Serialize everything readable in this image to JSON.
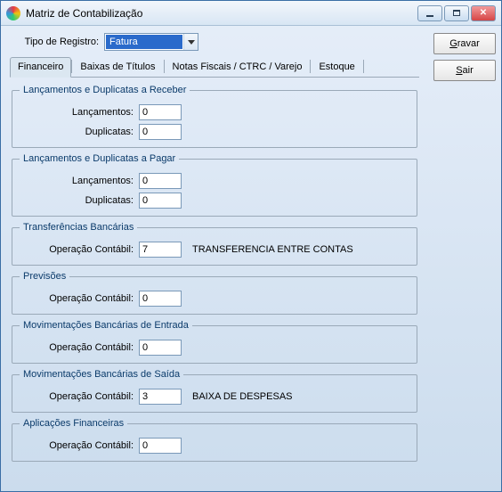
{
  "window": {
    "title": "Matriz de Contabilização"
  },
  "top": {
    "tipo_registro_label": "Tipo de Registro:",
    "tipo_registro_value": "Fatura"
  },
  "tabs": {
    "financeiro": "Financeiro",
    "baixas": "Baixas de Títulos",
    "notas": "Notas Fiscais / CTRC / Varejo",
    "estoque": "Estoque"
  },
  "groups": {
    "receber": {
      "legend": "Lançamentos e Duplicatas a Receber",
      "lancamentos_label": "Lançamentos:",
      "lancamentos_value": "0",
      "duplicatas_label": "Duplicatas:",
      "duplicatas_value": "0"
    },
    "pagar": {
      "legend": "Lançamentos e Duplicatas a Pagar",
      "lancamentos_label": "Lançamentos:",
      "lancamentos_value": "0",
      "duplicatas_label": "Duplicatas:",
      "duplicatas_value": "0"
    },
    "transf": {
      "legend": "Transferências Bancárias",
      "op_label": "Operação Contábil:",
      "op_value": "7",
      "op_desc": "TRANSFERENCIA ENTRE CONTAS"
    },
    "prev": {
      "legend": "Previsões",
      "op_label": "Operação Contábil:",
      "op_value": "0"
    },
    "mov_entrada": {
      "legend": "Movimentações Bancárias de Entrada",
      "op_label": "Operação Contábil:",
      "op_value": "0"
    },
    "mov_saida": {
      "legend": "Movimentações Bancárias de Saída",
      "op_label": "Operação Contábil:",
      "op_value": "3",
      "op_desc": "BAIXA DE DESPESAS"
    },
    "aplic": {
      "legend": "Aplicações Financeiras",
      "op_label": "Operação Contábil:",
      "op_value": "0"
    }
  },
  "buttons": {
    "gravar_u": "G",
    "gravar_rest": "ravar",
    "sair_u": "S",
    "sair_rest": "air"
  }
}
